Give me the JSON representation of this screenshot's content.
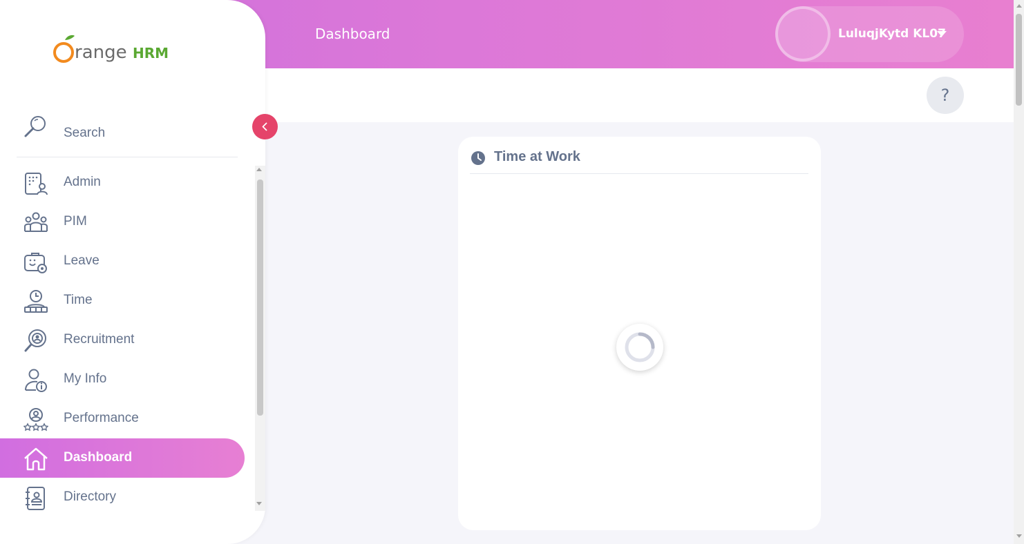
{
  "header": {
    "title": "Dashboard",
    "user_name": "LuluqjKytd KL07",
    "help_label": "?"
  },
  "sidebar": {
    "logo_text_main": "Orange",
    "logo_text_brand": "HRM",
    "search_label": "Search",
    "items": [
      {
        "label": "Admin",
        "icon": "admin-icon"
      },
      {
        "label": "PIM",
        "icon": "pim-icon"
      },
      {
        "label": "Leave",
        "icon": "leave-icon"
      },
      {
        "label": "Time",
        "icon": "time-icon"
      },
      {
        "label": "Recruitment",
        "icon": "recruitment-icon"
      },
      {
        "label": "My Info",
        "icon": "my-info-icon"
      },
      {
        "label": "Performance",
        "icon": "performance-icon"
      },
      {
        "label": "Dashboard",
        "icon": "home-icon",
        "active": true
      },
      {
        "label": "Directory",
        "icon": "directory-icon"
      }
    ]
  },
  "widget": {
    "title": "Time at Work"
  },
  "colors": {
    "accent_gradient_start": "#cd6fdc",
    "accent_gradient_end": "#e87fd0",
    "collapse_button": "#e5446a",
    "text": "#64728c"
  }
}
